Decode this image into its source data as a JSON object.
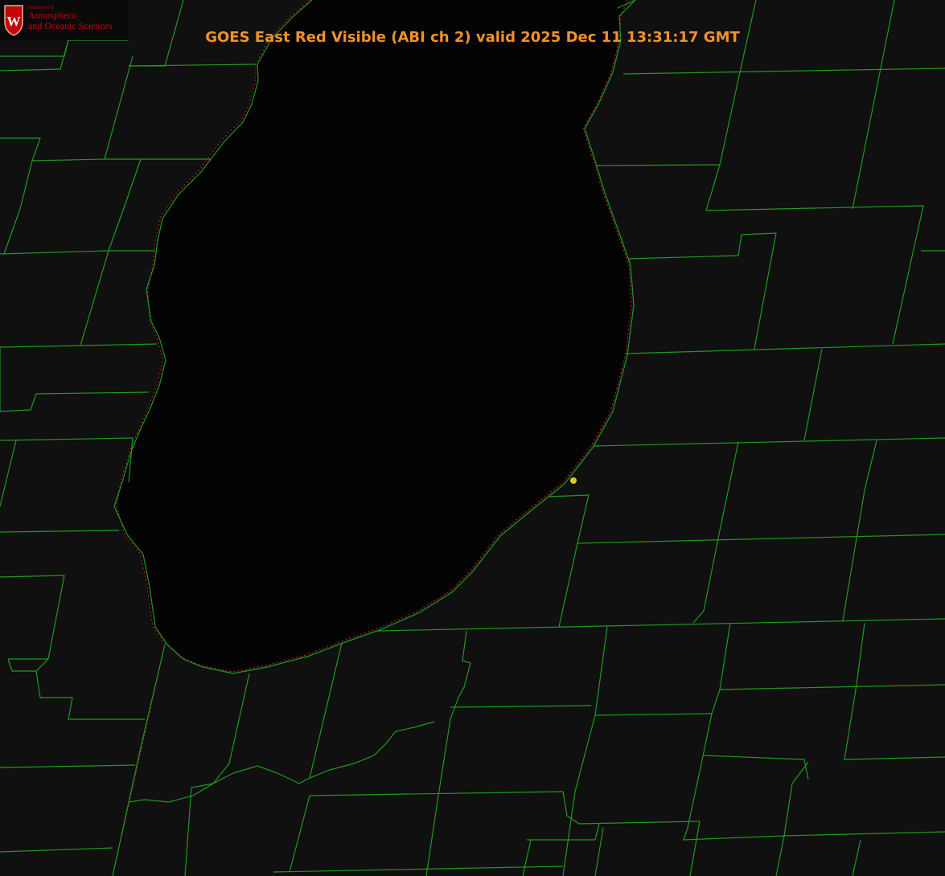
{
  "title": "GOES East Red Visible (ABI ch 2) valid 2025 Dec 11 13:31:17 GMT",
  "logo": {
    "department": "Department of",
    "line1": "Atmospheric",
    "line2": "and Oceanic Sciences",
    "crest_letter": "W",
    "crest_icon": "university-crest-icon"
  },
  "colors": {
    "background": "#000000",
    "lake": "#030303",
    "county_lines": "#1f9a1f",
    "state_line": "#cc2222",
    "title": "#f0922b",
    "marker": "#d4cf1c",
    "logo_text": "#c5050c"
  },
  "marker": {
    "name": "location-marker-icon"
  }
}
